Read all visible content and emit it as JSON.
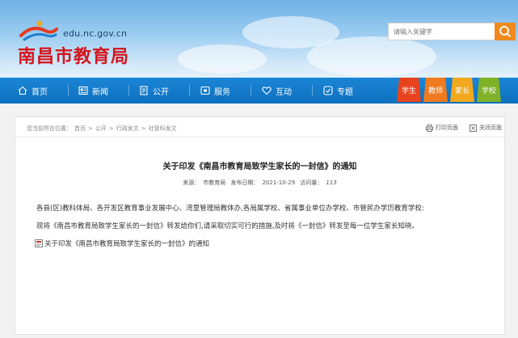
{
  "site": {
    "url": "edu.nc.gov.cn",
    "name": "南昌市教育局"
  },
  "search": {
    "placeholder": "请输入关键字"
  },
  "nav": {
    "items": [
      {
        "label": "首页",
        "icon": "home-icon"
      },
      {
        "label": "新闻",
        "icon": "news-icon"
      },
      {
        "label": "公开",
        "icon": "document-icon"
      },
      {
        "label": "服务",
        "icon": "service-icon"
      },
      {
        "label": "互动",
        "icon": "heart-icon"
      },
      {
        "label": "专题",
        "icon": "topic-icon"
      }
    ],
    "roles": [
      {
        "label": "学生",
        "color": "#e8431f"
      },
      {
        "label": "教师",
        "color": "#f07a1f"
      },
      {
        "label": "家长",
        "color": "#f2a81d"
      },
      {
        "label": "学校",
        "color": "#7fb228"
      }
    ]
  },
  "breadcrumb": {
    "prefix": "您当前所在位置：",
    "items": [
      "首页",
      "公开",
      "行政发文",
      "社管科发文"
    ],
    "separator": ">"
  },
  "tools": {
    "print": "打印页面",
    "close": "关闭页面"
  },
  "article": {
    "title": "关于印发《南昌市教育局致学生家长的一封信》的通知",
    "source_label": "来源：",
    "source": "市教育局",
    "date_label": "发布日期：",
    "date": "2021-10-29",
    "views_label": "访问量：",
    "views": "113",
    "paragraphs": [
      "各县(区)教科体局、各开发区教育事业发展中心、湾里管理局教体办,各局属学校、省属事业单位办学校、市管民办学历教育学校:",
      "现将《南昌市教育局致学生家长的一封信》转发给你们,请采取切实可行的措施,及时将《一封信》转发至每一位学生家长知晓。"
    ],
    "attachment": "关于印发《南昌市教育局致学生家长的一封信》的通知"
  },
  "colors": {
    "nav_blue": "#0d6fbd",
    "logo_red": "#d4141c",
    "search_orange": "#f08a1f"
  }
}
